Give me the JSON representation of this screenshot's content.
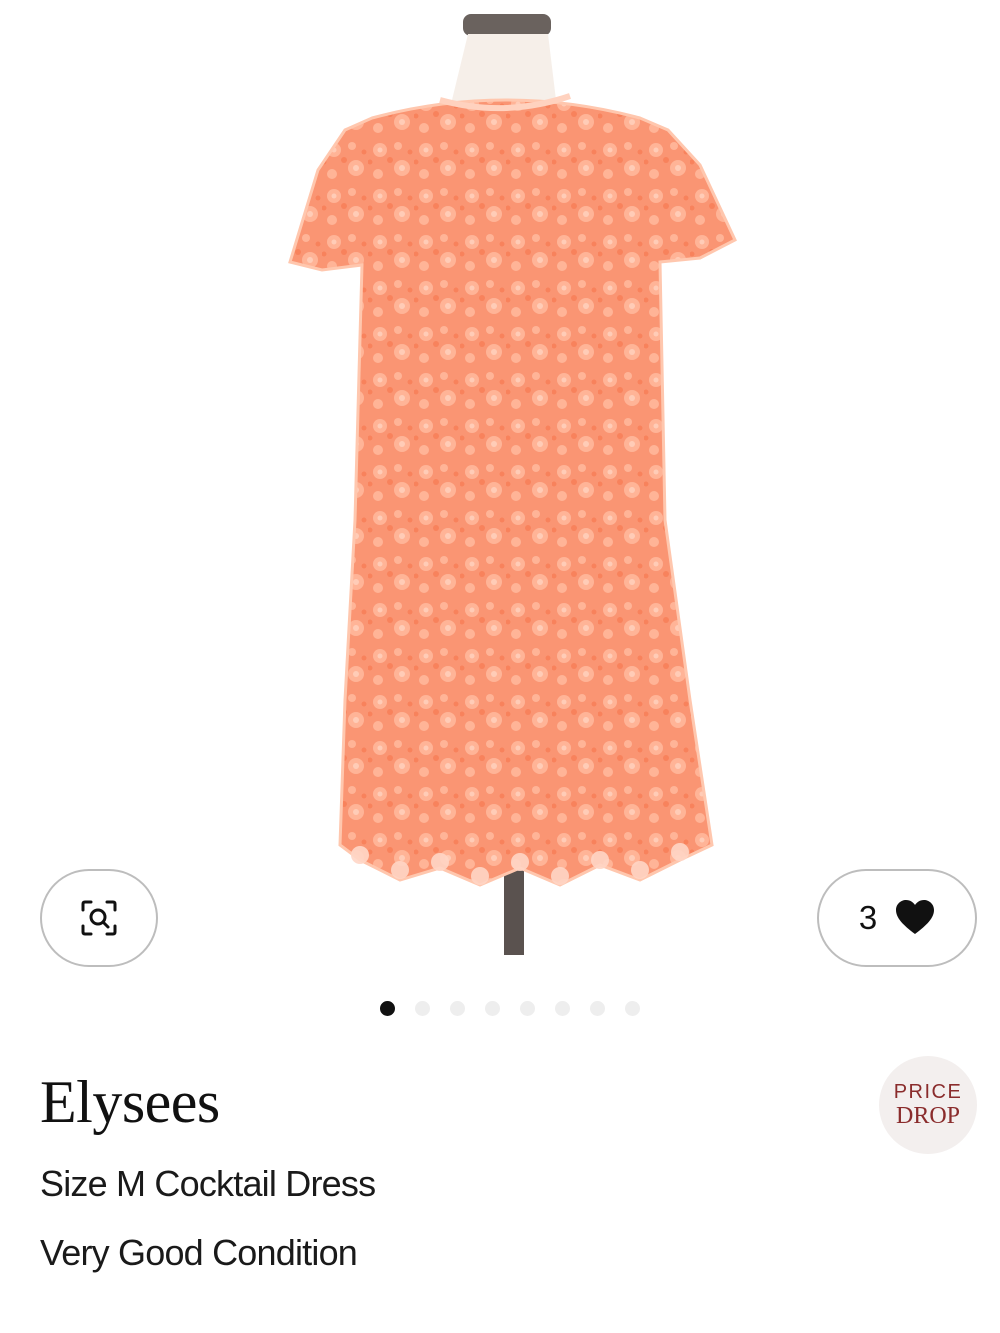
{
  "gallery": {
    "image_alt": "Coral lace cocktail dress on mannequin",
    "dress_color": "#f99a78",
    "slide_count": 8,
    "active_slide": 1
  },
  "zoom_button": {
    "icon": "zoom-scan-icon"
  },
  "likes": {
    "count": "3",
    "icon": "heart-icon"
  },
  "product": {
    "brand": "Elysees",
    "subtitle": "Size M Cocktail Dress",
    "condition": "Very Good Condition"
  },
  "badge": {
    "line1": "PRICE",
    "line2": "DROP",
    "color": "#8a2c2c"
  }
}
